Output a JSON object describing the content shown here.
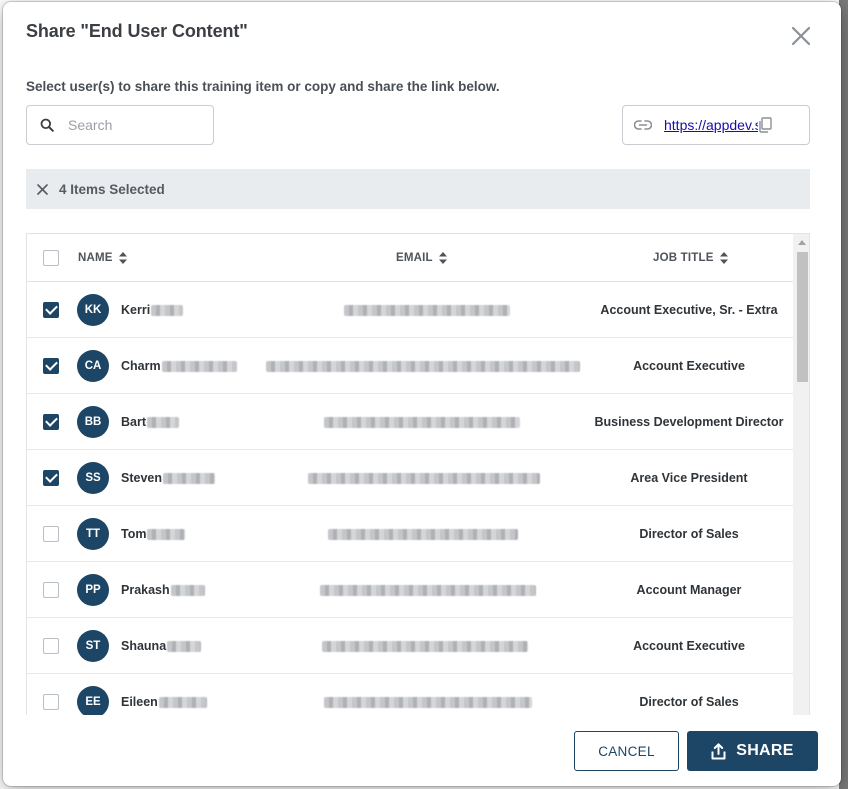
{
  "dialog": {
    "title": "Share \"End User Content\"",
    "subtitle": "Select user(s) to share this training item or copy and share the link below."
  },
  "search": {
    "placeholder": "Search",
    "value": ""
  },
  "share_link": {
    "text": "https://appdev.skilli"
  },
  "selection": {
    "text": "4 Items Selected"
  },
  "table": {
    "columns": {
      "name": "NAME",
      "email": "EMAIL",
      "job_title": "JOB TITLE"
    },
    "rows": [
      {
        "initials": "KK",
        "name": "Kerri",
        "job_title": "Account Executive, Sr. - Extra",
        "checked": true
      },
      {
        "initials": "CA",
        "name": "Charm",
        "job_title": "Account Executive",
        "checked": true
      },
      {
        "initials": "BB",
        "name": "Bart",
        "job_title": "Business Development Director",
        "checked": true
      },
      {
        "initials": "SS",
        "name": "Steven",
        "job_title": "Area Vice President",
        "checked": true
      },
      {
        "initials": "TT",
        "name": "Tom",
        "job_title": "Director of Sales",
        "checked": false
      },
      {
        "initials": "PP",
        "name": "Prakash",
        "job_title": "Account Manager",
        "checked": false
      },
      {
        "initials": "ST",
        "name": "Shauna",
        "job_title": "Account Executive",
        "checked": false
      },
      {
        "initials": "EE",
        "name": "Eileen",
        "job_title": "Director of Sales",
        "checked": false
      }
    ]
  },
  "footer": {
    "cancel_label": "CANCEL",
    "share_label": "SHARE"
  },
  "colors": {
    "primary": "#1c4566",
    "selected_bar": "#e9ecef"
  },
  "icons": {
    "close": "close-icon",
    "search": "search-icon",
    "link": "link-icon",
    "copy": "copy-icon",
    "sort": "sort-icon",
    "share": "share-icon"
  }
}
